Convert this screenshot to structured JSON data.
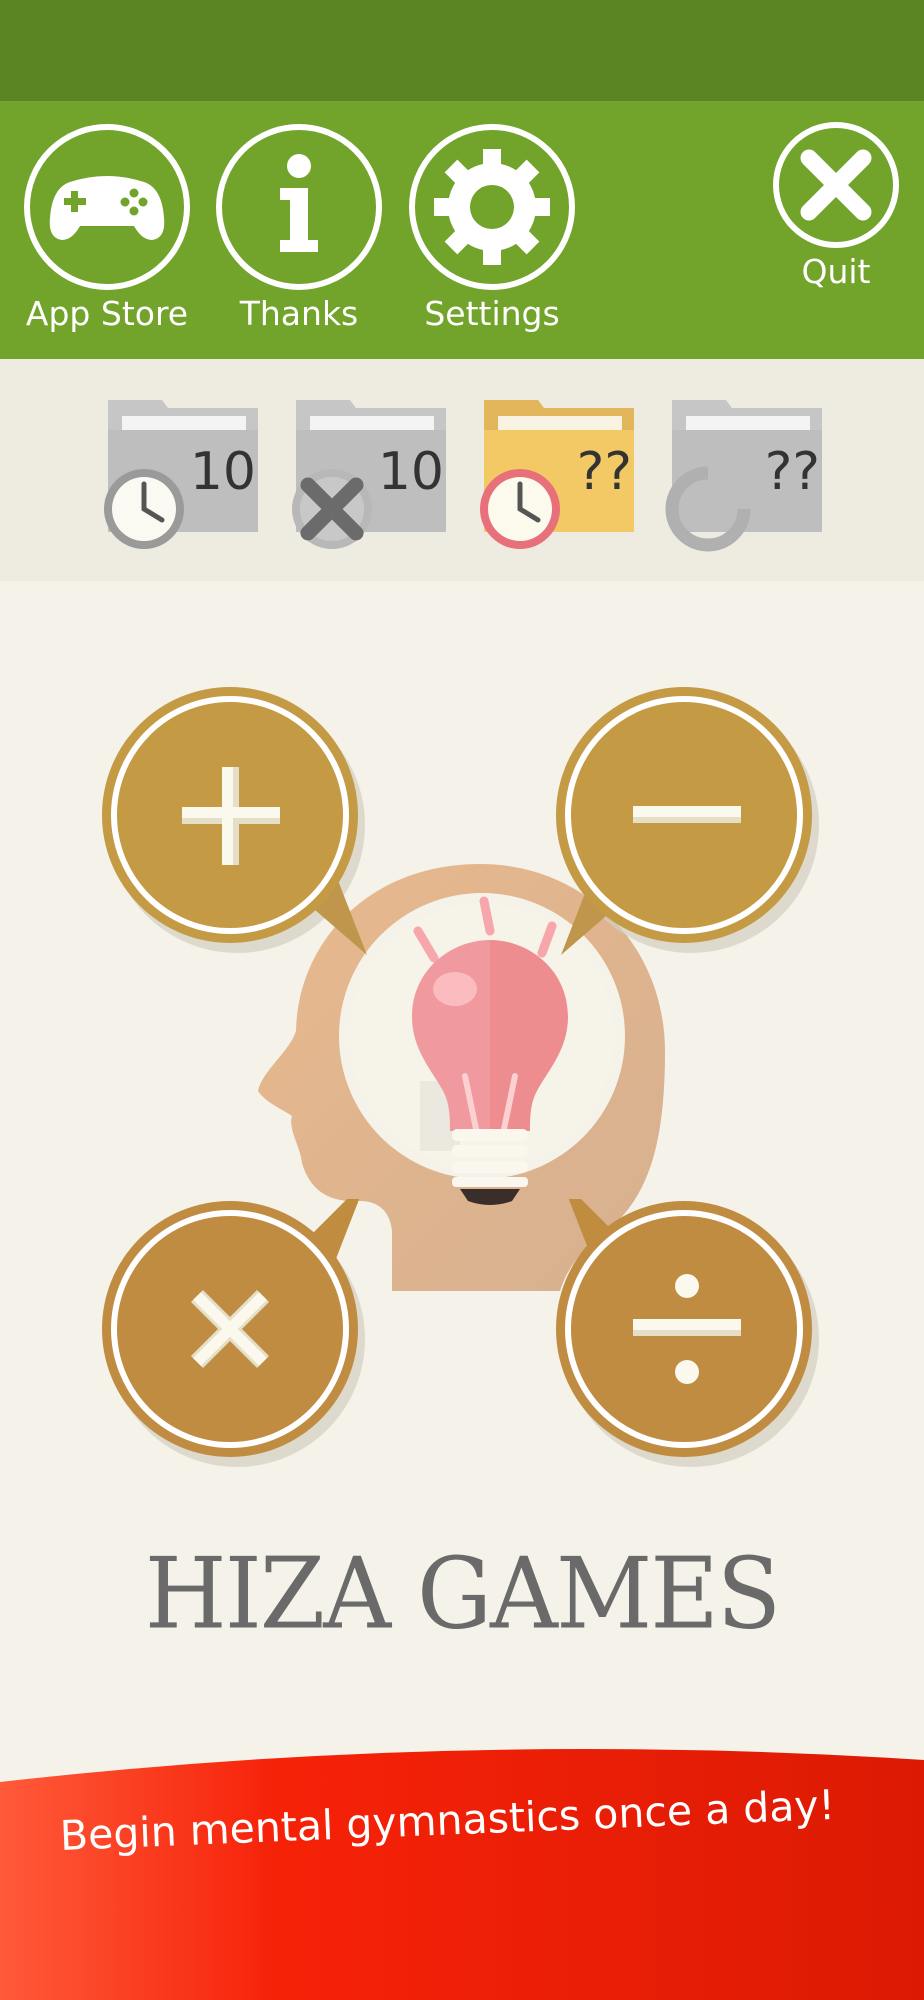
{
  "toolbar": {
    "app_store_label": "App Store",
    "thanks_label": "Thanks",
    "settings_label": "Settings",
    "quit_label": "Quit"
  },
  "folders": [
    {
      "count": "10",
      "overlay": "clock-icon",
      "state": "unlocked"
    },
    {
      "count": "10",
      "overlay": "x-mark-icon",
      "state": "unlocked"
    },
    {
      "count": "??",
      "overlay": "clock-icon",
      "state": "highlighted"
    },
    {
      "count": "??",
      "overlay": "refresh-icon",
      "state": "locked"
    }
  ],
  "operations": [
    "addition",
    "subtraction",
    "multiplication",
    "division"
  ],
  "brand": {
    "name": "HIZA GAMES"
  },
  "banner": {
    "text": "Begin mental gymnastics once a day!"
  },
  "colors": {
    "status_bar": "#5b8423",
    "toolbar": "#72a32b",
    "gold": "#b98c3f",
    "banner_red": "#f42a08"
  }
}
